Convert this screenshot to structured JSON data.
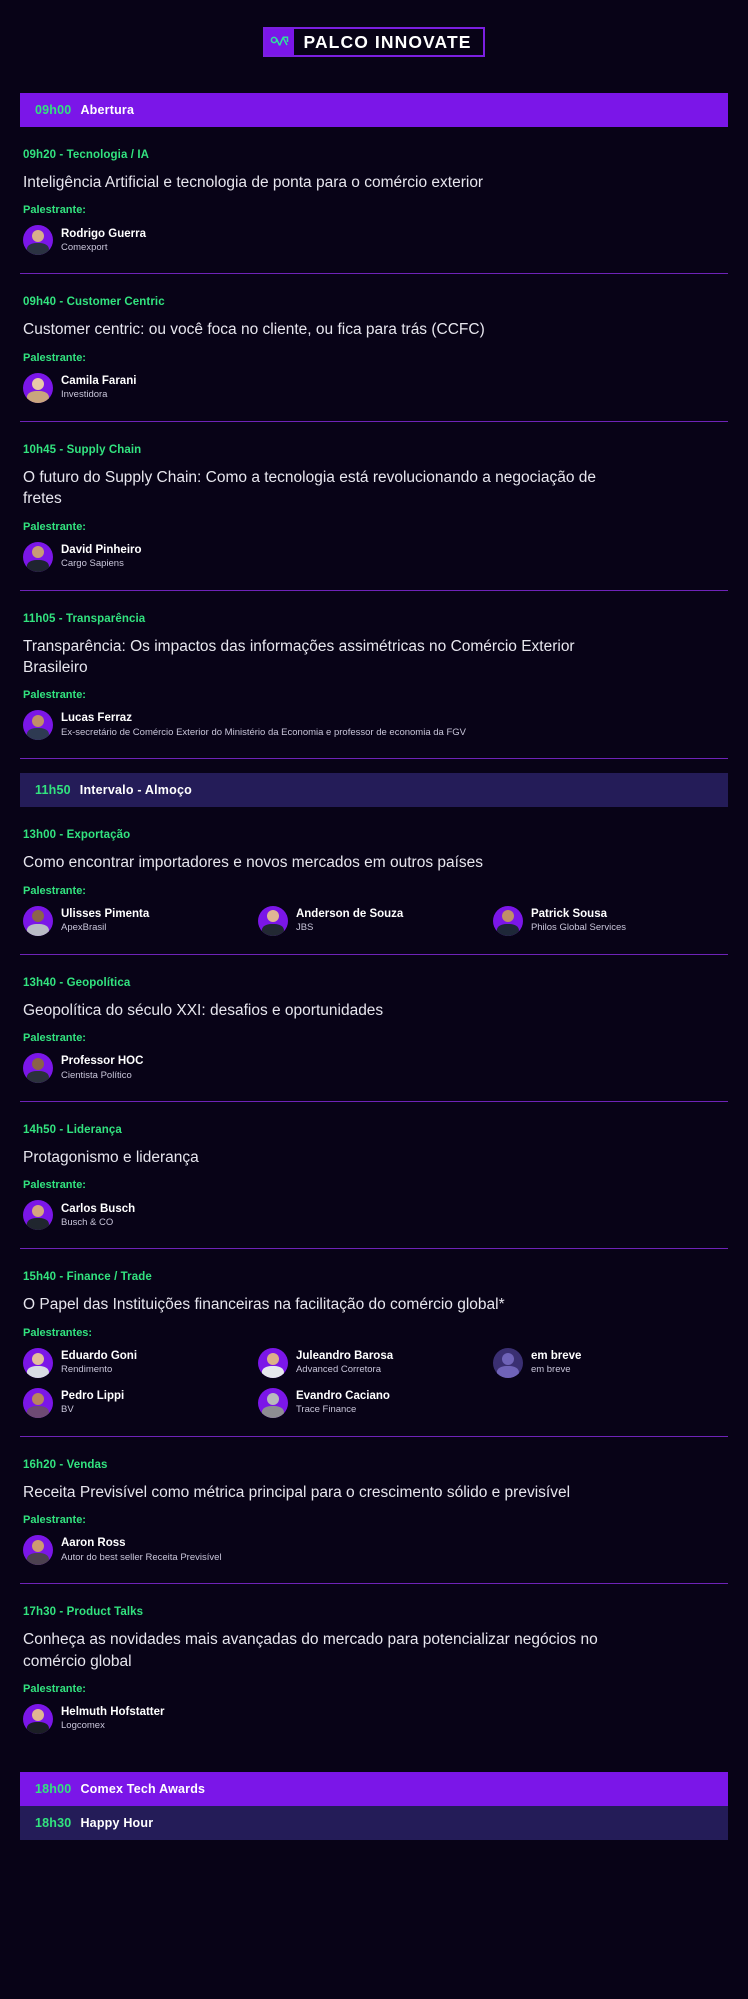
{
  "logo": {
    "mark_icon": "analytics-arrow-icon",
    "text": "PALCO INNOVATE",
    "mark_bg": "#7B16E8",
    "border": "#7B1FE0"
  },
  "colors": {
    "page_bg": "#080317",
    "banner_purple": "#7B16E8",
    "banner_navy": "#241C58",
    "accent_green": "#32E37F",
    "rule": "#6E23B8",
    "title_text": "#E7E6EE"
  },
  "banners": {
    "opening": {
      "time": "09h00",
      "label": "Abertura"
    },
    "lunch": {
      "time": "11h50",
      "label": "Intervalo - Almoço"
    },
    "awards": {
      "time": "18h00",
      "label": "Comex Tech Awards"
    },
    "happy_hour": {
      "time": "18h30",
      "label": "Happy Hour"
    }
  },
  "labels": {
    "speaker_singular": "Palestrante:",
    "speaker_plural": "Palestrantes:"
  },
  "sessions": [
    {
      "meta": "09h20 - Tecnologia / IA",
      "title": "Inteligência Artificial e tecnologia de ponta para o comércio exterior",
      "speakers_label": "Palestrante:",
      "speakers": [
        {
          "name": "Rodrigo Guerra",
          "org": "Comexport"
        }
      ]
    },
    {
      "meta": "09h40 - Customer Centric",
      "title": "Customer centric: ou você foca no cliente, ou fica para trás (CCFC)",
      "speakers_label": "Palestrante:",
      "speakers": [
        {
          "name": "Camila Farani",
          "org": "Investidora"
        }
      ]
    },
    {
      "meta": "10h45 - Supply Chain",
      "title": "O futuro do Supply Chain: Como a tecnologia está revolucionando a negociação de fretes",
      "speakers_label": "Palestrante:",
      "speakers": [
        {
          "name": "David Pinheiro",
          "org": "Cargo Sapiens"
        }
      ]
    },
    {
      "meta": "11h05 - Transparência",
      "title": "Transparência: Os impactos das informações assimétricas no Comércio Exterior  Brasileiro",
      "speakers_label": "Palestrante:",
      "speakers": [
        {
          "name": "Lucas Ferraz",
          "org": "Ex-secretário de Comércio Exterior do Ministério da Economia e professor de economia da FGV"
        }
      ]
    },
    {
      "meta": "13h00 - Exportação",
      "title": "Como encontrar importadores e novos mercados em outros países",
      "speakers_label": "Palestrante:",
      "speakers": [
        {
          "name": "Ulisses Pimenta",
          "org": "ApexBrasil"
        },
        {
          "name": "Anderson de Souza",
          "org": "JBS"
        },
        {
          "name": "Patrick Sousa",
          "org": "Philos Global Services"
        }
      ]
    },
    {
      "meta": "13h40 - Geopolítica",
      "title": "Geopolítica do século XXI: desafios e oportunidades",
      "speakers_label": "Palestrante:",
      "speakers": [
        {
          "name": "Professor HOC",
          "org": "Cientista Político"
        }
      ]
    },
    {
      "meta": "14h50 - Liderança",
      "title": "Protagonismo e liderança",
      "speakers_label": "Palestrante:",
      "speakers": [
        {
          "name": "Carlos Busch",
          "org": "Busch & CO"
        }
      ]
    },
    {
      "meta": "15h40 - Finance / Trade",
      "title": "O Papel das Instituições financeiras na facilitação do comércio global*",
      "speakers_label": "Palestrantes:",
      "speakers": [
        {
          "name": "Eduardo Goni",
          "org": "Rendimento"
        },
        {
          "name": "Juleandro Barosa",
          "org": "Advanced Corretora"
        },
        {
          "name": "em breve",
          "org": "em breve",
          "placeholder": true
        },
        {
          "name": "Pedro Lippi",
          "org": "BV"
        },
        {
          "name": "Evandro Caciano",
          "org": "Trace Finance"
        }
      ]
    },
    {
      "meta": "16h20 - Vendas",
      "title": "Receita Previsível como métrica principal para o crescimento sólido e previsível",
      "speakers_label": "Palestrante:",
      "speakers": [
        {
          "name": "Aaron Ross",
          "org": "Autor do best seller Receita Previsível"
        }
      ]
    },
    {
      "meta": "17h30 - Product Talks",
      "title": "Conheça as novidades mais avançadas do mercado para potencializar negócios no comércio global",
      "speakers_label": "Palestrante:",
      "speakers": [
        {
          "name": "Helmuth Hofstatter",
          "org": "Logcomex"
        }
      ]
    }
  ]
}
